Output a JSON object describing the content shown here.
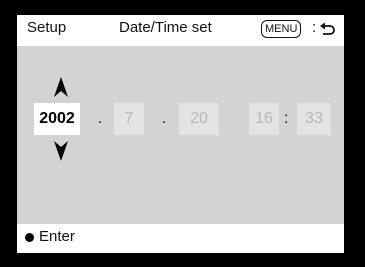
{
  "header": {
    "left_title": "Setup",
    "center_title": "Date/Time set",
    "menu_key": "MENU",
    "menu_colon": ":",
    "back_icon": "return-arrow-icon"
  },
  "fields": {
    "year": "2002",
    "sep1": ".",
    "month": "7",
    "sep2": ".",
    "day": "20",
    "hour": "16",
    "time_sep": ":",
    "minute": "33"
  },
  "footer": {
    "enter_label": "Enter",
    "enter_icon": "filled-circle-icon"
  },
  "colors": {
    "background": "#000000",
    "panel": "#d3d3d3",
    "bars": "#ffffff",
    "selected_field": "#ffffff",
    "inactive_text": "#b5b5b5"
  }
}
